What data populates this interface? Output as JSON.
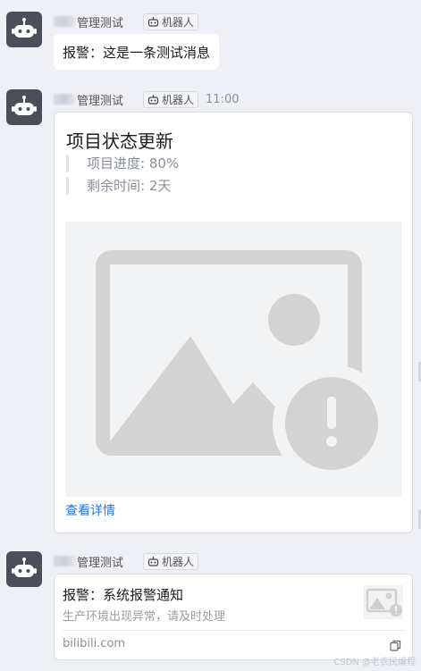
{
  "sender": {
    "name": "管理测试",
    "bot_label": "机器人"
  },
  "messages": [
    {
      "text": "报警：这是一条测试消息"
    },
    {
      "time": "11:00",
      "card": {
        "title": "项目状态更新",
        "lines": [
          "项目进度: 80%",
          "剩余时间: 2天"
        ],
        "link": "查看详情"
      }
    },
    {
      "link_card": {
        "title": "报警：系统报警通知",
        "subtitle": "生产环境出现异常，请及时处理",
        "source": "bilibili.com"
      }
    }
  ],
  "watermark": "CSDN @老农民编程",
  "colors": {
    "background": "#eef0f5",
    "link": "#2a73d8",
    "avatar": "#4a4f5a"
  },
  "icons": [
    "bot-avatar-icon",
    "robot-icon",
    "broken-image-icon",
    "copy-icon"
  ]
}
